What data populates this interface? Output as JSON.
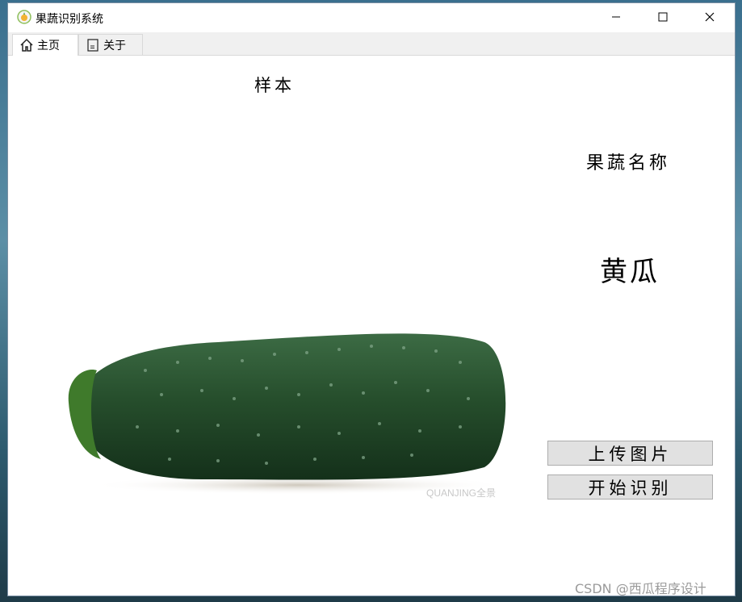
{
  "window": {
    "title": "果蔬识别系统",
    "controls": [
      "minimize",
      "maximize",
      "close"
    ]
  },
  "tabs": [
    {
      "label": "主页",
      "icon": "home-icon",
      "active": true
    },
    {
      "label": "关于",
      "icon": "document-icon",
      "active": false
    }
  ],
  "main": {
    "sample_label": "样本",
    "name_label": "果蔬名称",
    "result": "黄瓜",
    "image_watermark": "QUANJING全景"
  },
  "buttons": {
    "upload": "上传图片",
    "recognize": "开始识别"
  },
  "footer": {
    "watermark": "CSDN @西瓜程序设计"
  }
}
